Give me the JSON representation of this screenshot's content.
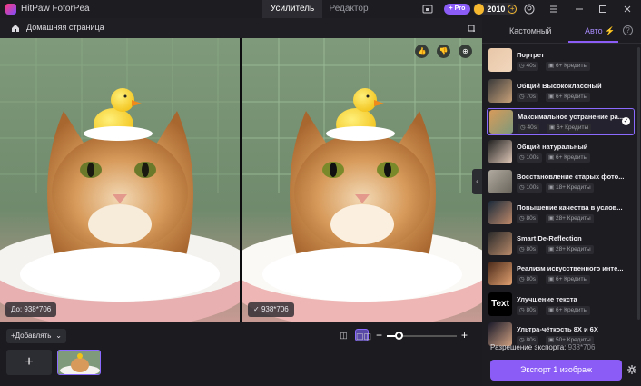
{
  "app": {
    "title": "HitPaw FotorPea"
  },
  "tabs": [
    {
      "label": "Усилитель",
      "active": true
    },
    {
      "label": "Редактор",
      "active": false
    }
  ],
  "header": {
    "pro_label": "+ Pro",
    "coins": "2010"
  },
  "breadcrumb": {
    "home_label": "Домашняя страница"
  },
  "viewer": {
    "left_size": "До: 938*706",
    "right_size": "938*706"
  },
  "bottom": {
    "add_label": "Добавлять"
  },
  "panel": {
    "tabs": [
      {
        "label": "Кастомный"
      },
      {
        "label": "Авто"
      }
    ],
    "models": [
      {
        "name": "Портрет",
        "time": "40s",
        "credits": "6+ Кредиты",
        "selected": false
      },
      {
        "name": "Общий Высококлассный",
        "time": "70s",
        "credits": "6+ Кредиты",
        "selected": false
      },
      {
        "name": "Максимальное устранение ра...",
        "time": "40s",
        "credits": "6+ Кредиты",
        "selected": true
      },
      {
        "name": "Общий натуральный",
        "time": "100s",
        "credits": "6+ Кредиты",
        "selected": false
      },
      {
        "name": "Восстановление старых фото...",
        "time": "100s",
        "credits": "18+ Кредиты",
        "selected": false
      },
      {
        "name": "Повышение качества в услов...",
        "time": "80s",
        "credits": "28+ Кредиты",
        "selected": false
      },
      {
        "name": "Smart De-Reflection",
        "time": "80s",
        "credits": "28+ Кредиты",
        "selected": false
      },
      {
        "name": "Реализм искусственного инте...",
        "time": "80s",
        "credits": "6+ Кредиты",
        "selected": false
      },
      {
        "name": "Улучшение текста",
        "time": "80s",
        "credits": "6+ Кредиты",
        "selected": false
      },
      {
        "name": "Ультра-чёткость 8Х и 6Х",
        "time": "80s",
        "credits": "50+ Кредиты",
        "selected": false
      }
    ],
    "export_res_label": "Разрешение экспорта:",
    "export_res_value": "938*706",
    "export_button": "Экспорт 1 изображ",
    "thumb_text_label": "Text"
  },
  "colors": {
    "accent": "#8b5cf6",
    "coin": "#f5b82e"
  },
  "zoom_level": 0.18
}
